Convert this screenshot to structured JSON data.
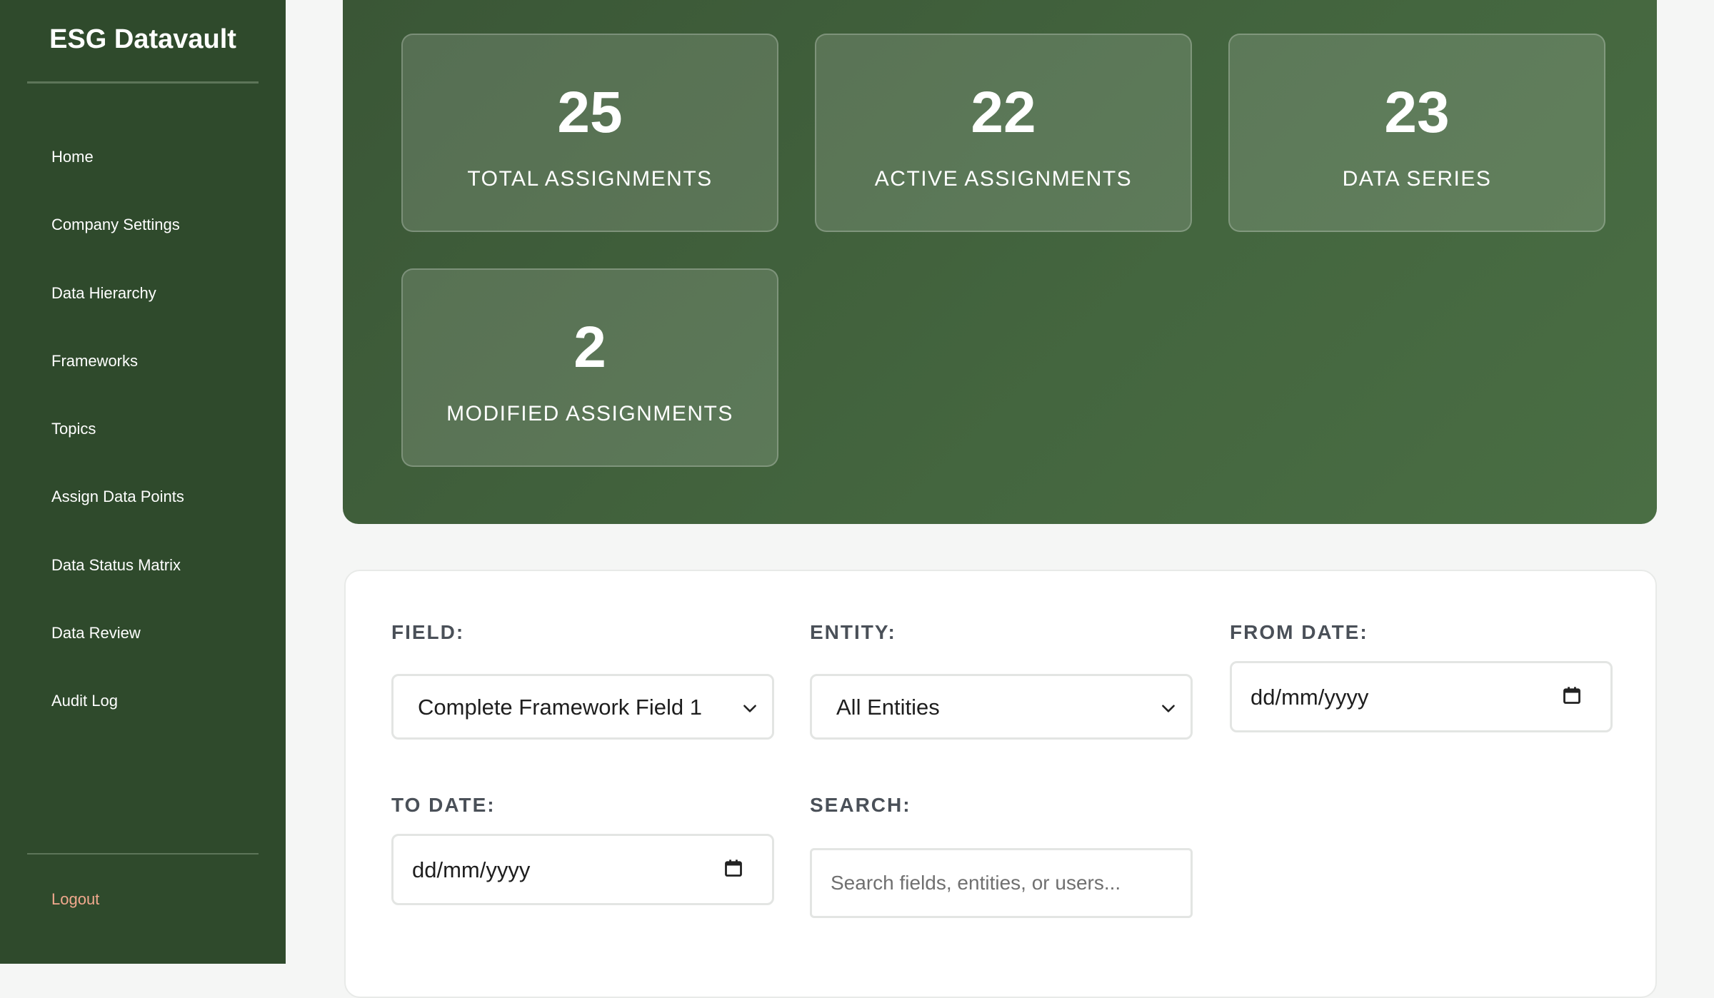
{
  "sidebar": {
    "brand": "ESG Datavault",
    "items": [
      {
        "label": "Home"
      },
      {
        "label": "Company Settings"
      },
      {
        "label": "Data Hierarchy"
      },
      {
        "label": "Frameworks"
      },
      {
        "label": "Topics"
      },
      {
        "label": "Assign Data Points"
      },
      {
        "label": "Data Status Matrix"
      },
      {
        "label": "Data Review"
      },
      {
        "label": "Audit Log"
      }
    ],
    "logout": "Logout"
  },
  "stats": [
    {
      "value": "25",
      "label": "TOTAL ASSIGNMENTS"
    },
    {
      "value": "22",
      "label": "ACTIVE ASSIGNMENTS"
    },
    {
      "value": "23",
      "label": "DATA SERIES"
    },
    {
      "value": "2",
      "label": "MODIFIED ASSIGNMENTS"
    }
  ],
  "filters": {
    "field_label": "FIELD:",
    "field_value": "Complete Framework Field 1",
    "entity_label": "ENTITY:",
    "entity_value": "All Entities",
    "from_label": "FROM DATE:",
    "from_value": "dd/mm/yyyy",
    "to_label": "TO DATE:",
    "to_value": "dd/mm/yyyy",
    "search_label": "SEARCH:",
    "search_placeholder": "Search fields, entities, or users..."
  },
  "colors": {
    "sidebar_bg": "#2f4a2c",
    "panel_bg": "#3f5f3a",
    "logout": "#f2a98e"
  }
}
